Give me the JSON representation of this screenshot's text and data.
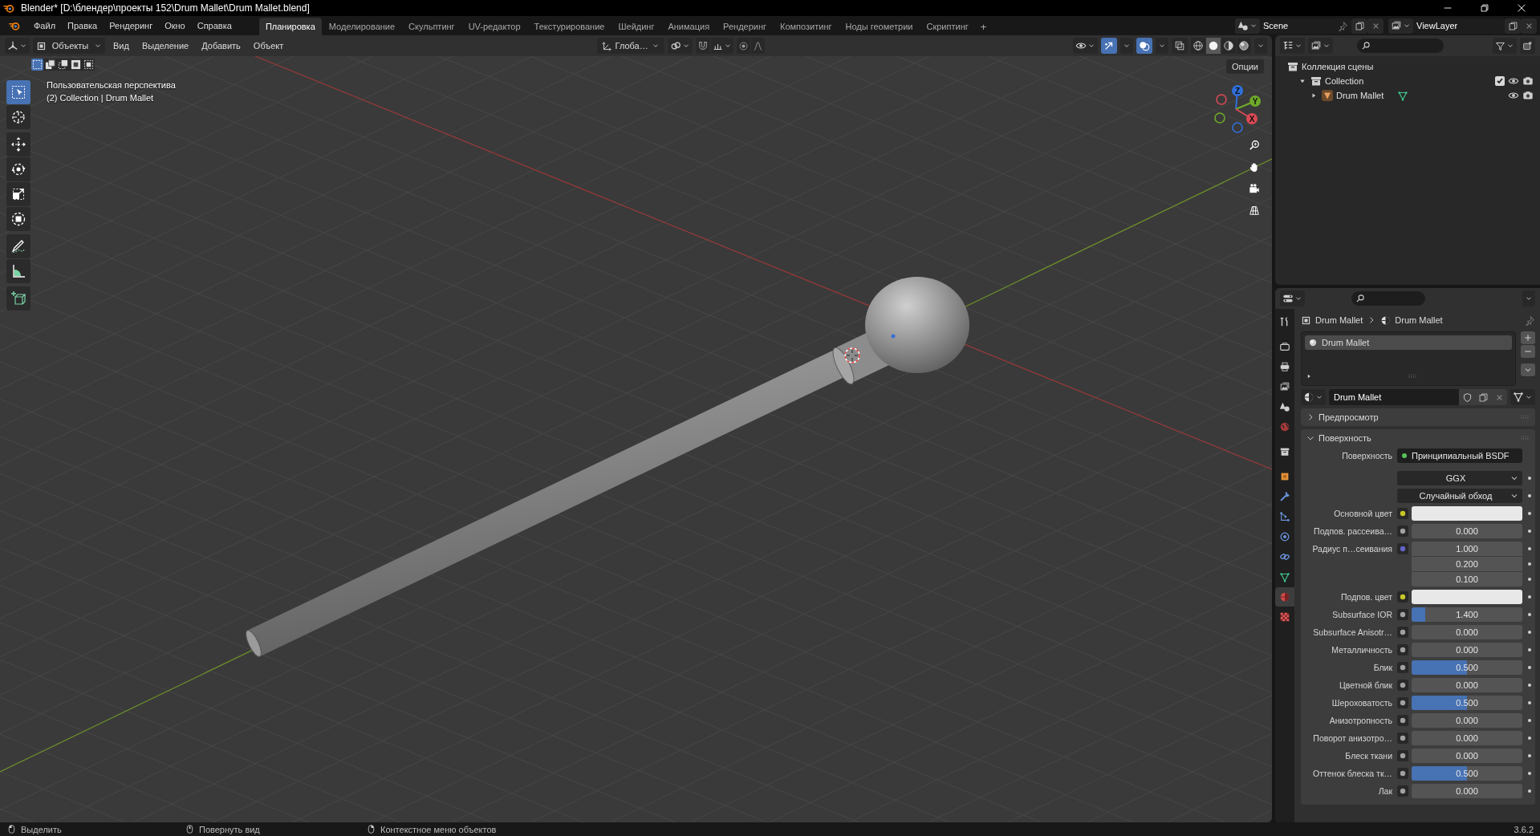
{
  "window": {
    "title": "Blender* [D:\\блендер\\проекты 152\\Drum Mallet\\Drum Mallet.blend]"
  },
  "menu": [
    "Файл",
    "Правка",
    "Рендеринг",
    "Окно",
    "Справка"
  ],
  "workspaces": [
    {
      "label": "Планировка",
      "selected": true
    },
    {
      "label": "Моделирование",
      "selected": false
    },
    {
      "label": "Скульптинг",
      "selected": false
    },
    {
      "label": "UV-редактор",
      "selected": false
    },
    {
      "label": "Текстурирование",
      "selected": false
    },
    {
      "label": "Шейдинг",
      "selected": false
    },
    {
      "label": "Анимация",
      "selected": false
    },
    {
      "label": "Рендеринг",
      "selected": false
    },
    {
      "label": "Композитинг",
      "selected": false
    },
    {
      "label": "Ноды геометрии",
      "selected": false
    },
    {
      "label": "Скриптинг",
      "selected": false
    }
  ],
  "add_workspace": "+",
  "scene": "Scene",
  "view_layer": "ViewLayer",
  "viewport": {
    "mode": "Объекты",
    "menus": [
      "Вид",
      "Выделение",
      "Добавить",
      "Объект"
    ],
    "orientation": "Глоба…",
    "options": "Опции",
    "view_name": "Пользовательская перспектива",
    "collection_info": "(2) Collection | Drum Mallet",
    "select_modes": [
      {
        "selected": true
      },
      {
        "selected": false
      },
      {
        "selected": false
      },
      {
        "selected": false
      },
      {
        "selected": false
      }
    ],
    "tools": [
      {
        "kind": "select",
        "selected": true
      },
      {
        "kind": "cursor",
        "selected": false
      },
      {
        "kind": "move",
        "selected": false
      },
      {
        "kind": "rotate",
        "selected": false
      },
      {
        "kind": "scale",
        "selected": false
      },
      {
        "kind": "transform",
        "selected": false
      },
      {
        "kind": "annotate",
        "selected": false
      },
      {
        "kind": "measure",
        "selected": false
      },
      {
        "kind": "add_cube",
        "selected": false
      }
    ],
    "toggles": [
      {
        "kind": "gizmos",
        "on": true
      },
      {
        "kind": "overlays",
        "on": true
      },
      {
        "kind": "xray",
        "on": false
      }
    ],
    "shading": [
      {
        "kind": "wireframe",
        "selected": false
      },
      {
        "kind": "solid",
        "selected": true
      },
      {
        "kind": "material",
        "selected": false
      },
      {
        "kind": "rendered",
        "selected": false
      }
    ],
    "gizmo_axes": [
      {
        "kind": "z",
        "label": "Z"
      },
      {
        "kind": "y",
        "label": "Y"
      },
      {
        "kind": "x",
        "label": "X"
      }
    ]
  },
  "outliner": {
    "tree": [
      {
        "kind": "scene_collection",
        "label": "Коллекция сцены",
        "children": [
          {
            "kind": "collection",
            "label": "Collection",
            "expanded": true,
            "checked": true,
            "children": [
              {
                "kind": "object",
                "label": "Drum Mallet",
                "expanded": false
              }
            ]
          }
        ]
      }
    ]
  },
  "properties": {
    "tabs": [
      {
        "kind": "tool",
        "selected": false
      },
      {
        "kind": "render",
        "selected": false
      },
      {
        "kind": "output",
        "selected": false
      },
      {
        "kind": "view_layer",
        "selected": false
      },
      {
        "kind": "scene",
        "selected": false
      },
      {
        "kind": "world",
        "selected": false
      },
      {
        "kind": "collection",
        "selected": false
      },
      {
        "kind": "object",
        "selected": false
      },
      {
        "kind": "modifier",
        "selected": false
      },
      {
        "kind": "particles",
        "selected": false
      },
      {
        "kind": "physics",
        "selected": false
      },
      {
        "kind": "constraint",
        "selected": false
      },
      {
        "kind": "data",
        "selected": false
      },
      {
        "kind": "material",
        "selected": true
      },
      {
        "kind": "texture",
        "selected": false
      }
    ],
    "breadcrumb": [
      {
        "kind": "object",
        "label": "Drum Mallet"
      },
      {
        "kind": "material",
        "label": "Drum Mallet"
      }
    ],
    "material_slots": [
      {
        "label": "Drum Mallet",
        "selected": true
      }
    ],
    "material_name": "Drum Mallet",
    "panels": [
      {
        "label": "Предпросмотр",
        "expanded": false
      },
      {
        "label": "Поверхность",
        "expanded": true
      }
    ],
    "surface": {
      "label": "Поверхность",
      "value": "Принципиальный BSDF"
    },
    "fields": [
      {
        "kind": "dropdown",
        "value": "GGX"
      },
      {
        "kind": "dropdown",
        "value": "Случайный обход"
      },
      {
        "kind": "color",
        "label": "Основной цвет"
      },
      {
        "kind": "number",
        "label": "Подпов. рассеива…",
        "value": "0.000"
      },
      {
        "kind": "vector",
        "label": "Радиус п…сеивания",
        "values": [
          "1.000",
          "0.200",
          "0.100"
        ]
      },
      {
        "kind": "color",
        "label": "Подпов. цвет"
      },
      {
        "kind": "number",
        "label": "Subsurface IOR",
        "value": "1.400",
        "level": 0.12
      },
      {
        "kind": "number",
        "label": "Subsurface Anisotr…",
        "value": "0.000"
      },
      {
        "kind": "number",
        "label": "Металличность",
        "value": "0.000"
      },
      {
        "kind": "number",
        "label": "Блик",
        "value": "0.500",
        "level": 0.5
      },
      {
        "kind": "number",
        "label": "Цветной блик",
        "value": "0.000"
      },
      {
        "kind": "number",
        "label": "Шероховатость",
        "value": "0.500",
        "level": 0.5
      },
      {
        "kind": "number",
        "label": "Анизотропность",
        "value": "0.000"
      },
      {
        "kind": "number",
        "label": "Поворот анизотро…",
        "value": "0.000"
      },
      {
        "kind": "number",
        "label": "Блеск ткани",
        "value": "0.000"
      },
      {
        "kind": "number",
        "label": "Оттенок блеска тк…",
        "value": "0.500",
        "level": 0.5
      },
      {
        "kind": "number",
        "label": "Лак",
        "value": "0.000"
      }
    ]
  },
  "status": [
    {
      "kind": "left",
      "label": "Выделить"
    },
    {
      "kind": "middle",
      "label": "Повернуть вид"
    },
    {
      "kind": "right",
      "label": "Контекстное меню объектов"
    }
  ],
  "version": "3.6.2"
}
